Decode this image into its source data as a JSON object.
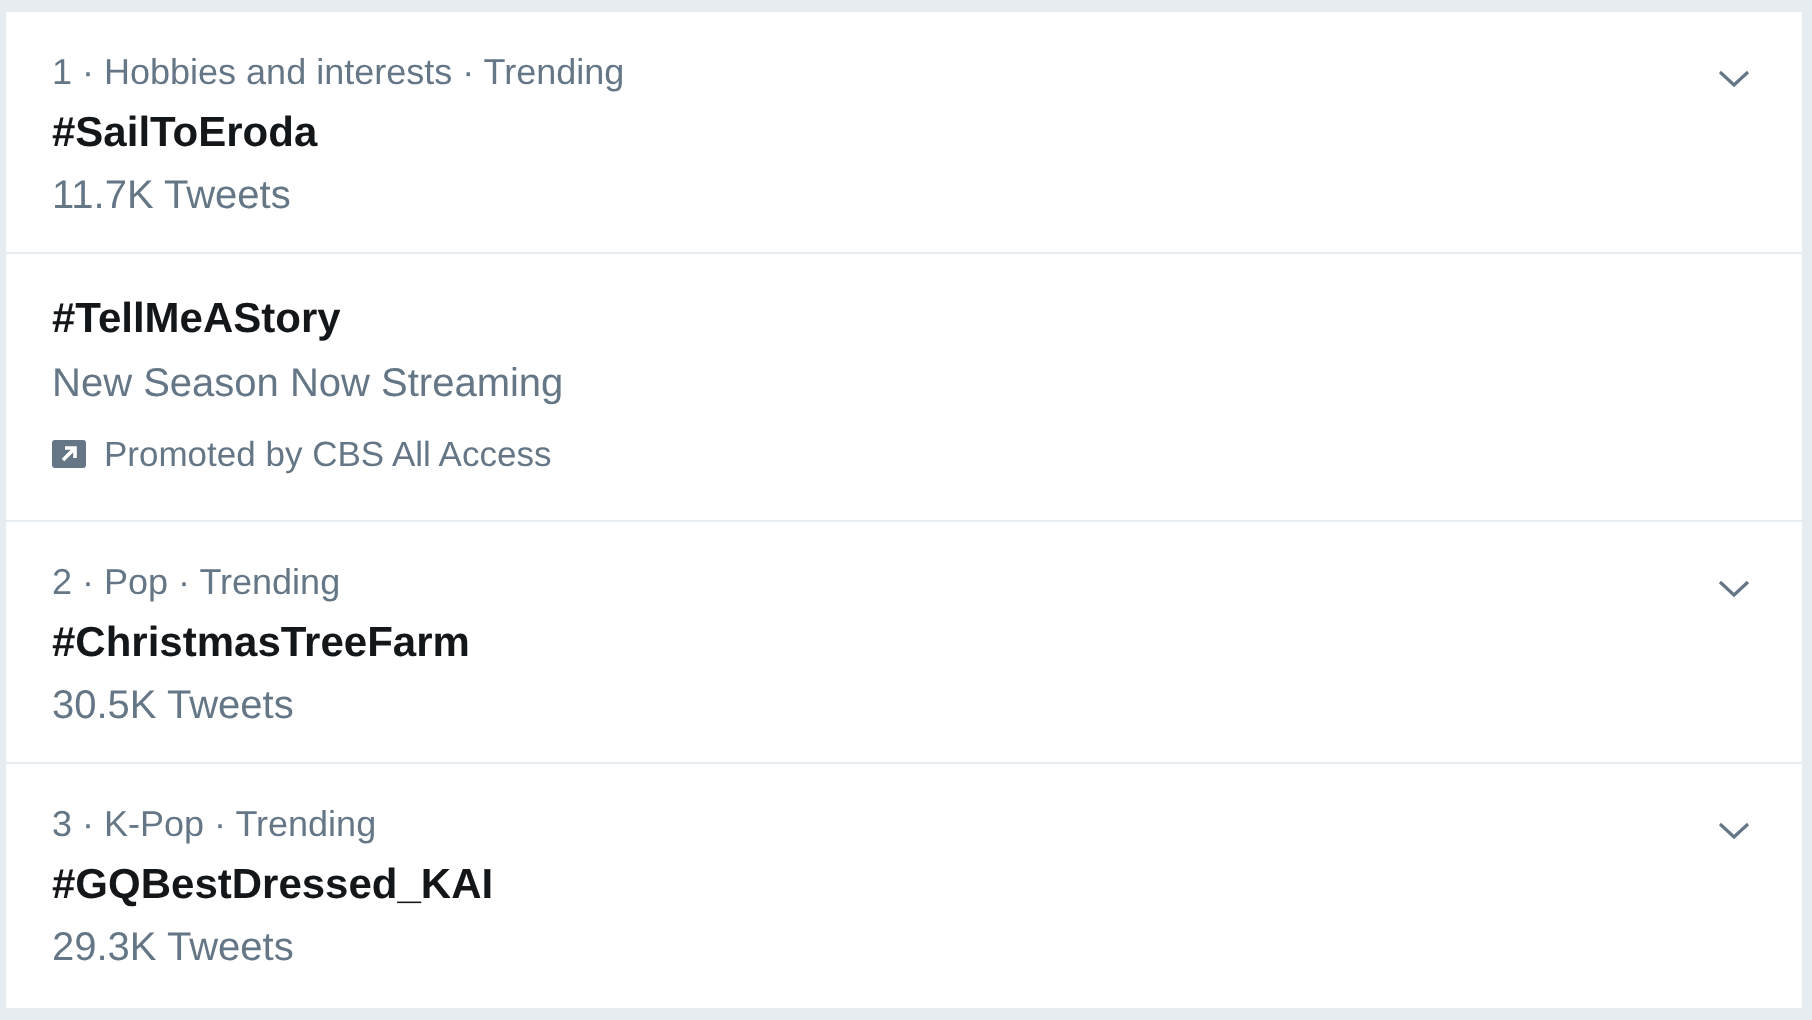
{
  "trends": [
    {
      "kind": "trend",
      "context": "1 · Hobbies and interests · Trending",
      "name": "#SailToEroda",
      "count": "11.7K Tweets"
    },
    {
      "kind": "promoted",
      "name": "#TellMeAStory",
      "description": "New Season Now Streaming",
      "promoter": "Promoted by CBS All Access"
    },
    {
      "kind": "trend",
      "context": "2 · Pop · Trending",
      "name": "#ChristmasTreeFarm",
      "count": "30.5K Tweets"
    },
    {
      "kind": "trend",
      "context": "3 · K-Pop · Trending",
      "name": "#GQBestDressed_KAI",
      "count": "29.3K Tweets"
    }
  ]
}
